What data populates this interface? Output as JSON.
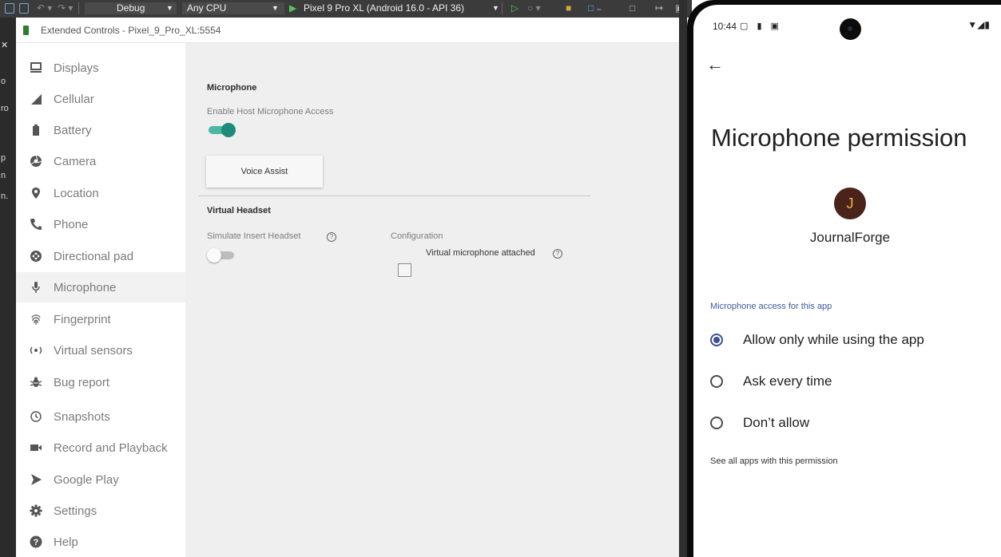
{
  "toolbar": {
    "config": "Debug",
    "platform": "Any CPU",
    "device": "Pixel 9 Pro XL (Android 16.0 - API 36)"
  },
  "ide": {
    "fragments": [
      "o",
      "ro",
      "p",
      "n",
      "n."
    ]
  },
  "window": {
    "title": "Extended Controls - Pixel_9_Pro_XL:5554"
  },
  "nav": {
    "items": [
      {
        "label": "Displays",
        "icon": "monitor-icon"
      },
      {
        "label": "Cellular",
        "icon": "signal-icon"
      },
      {
        "label": "Battery",
        "icon": "battery-icon"
      },
      {
        "label": "Camera",
        "icon": "camera-aperture-icon"
      },
      {
        "label": "Location",
        "icon": "location-pin-icon"
      },
      {
        "label": "Phone",
        "icon": "phone-icon"
      },
      {
        "label": "Directional pad",
        "icon": "dpad-icon"
      },
      {
        "label": "Microphone",
        "icon": "microphone-icon"
      },
      {
        "label": "Fingerprint",
        "icon": "fingerprint-icon"
      },
      {
        "label": "Virtual sensors",
        "icon": "sensors-icon"
      },
      {
        "label": "Bug report",
        "icon": "bug-icon"
      },
      {
        "label": "Snapshots",
        "icon": "history-icon"
      },
      {
        "label": "Record and Playback",
        "icon": "video-camera-icon"
      },
      {
        "label": "Google Play",
        "icon": "play-store-icon"
      },
      {
        "label": "Settings",
        "icon": "gear-icon"
      },
      {
        "label": "Help",
        "icon": "help-icon"
      }
    ],
    "active": "Microphone"
  },
  "microphone": {
    "section_title": "Microphone",
    "enable_label": "Enable Host Microphone Access",
    "enable_on": true,
    "voice_assist_label": "Voice Assist"
  },
  "headset": {
    "section_title": "Virtual Headset",
    "simulate_label": "Simulate Insert Headset",
    "simulate_on": false,
    "config_label": "Configuration",
    "mic_attached_label": "Virtual microphone attached",
    "mic_attached_checked": false,
    "help_glyph": "?"
  },
  "phone": {
    "time": "10:44",
    "status_left_icons": "▢ ▮ ▣",
    "status_right_icons": "▼◢▮",
    "back": "←",
    "title": "Microphone permission",
    "app_initial": "J",
    "app_name": "JournalForge",
    "section_header": "Microphone access for this app",
    "options": [
      {
        "label": "Allow only while using the app",
        "selected": true
      },
      {
        "label": "Ask every time",
        "selected": false
      },
      {
        "label": "Don’t allow",
        "selected": false
      }
    ],
    "see_all": "See all apps with this permission"
  },
  "colors": {
    "toggle_on": "#1e8a7a",
    "radio_selected": "#3d4f97",
    "avatar_bg": "#4a241a",
    "avatar_fg": "#f2b33d",
    "section_header": "#3d5a98"
  }
}
